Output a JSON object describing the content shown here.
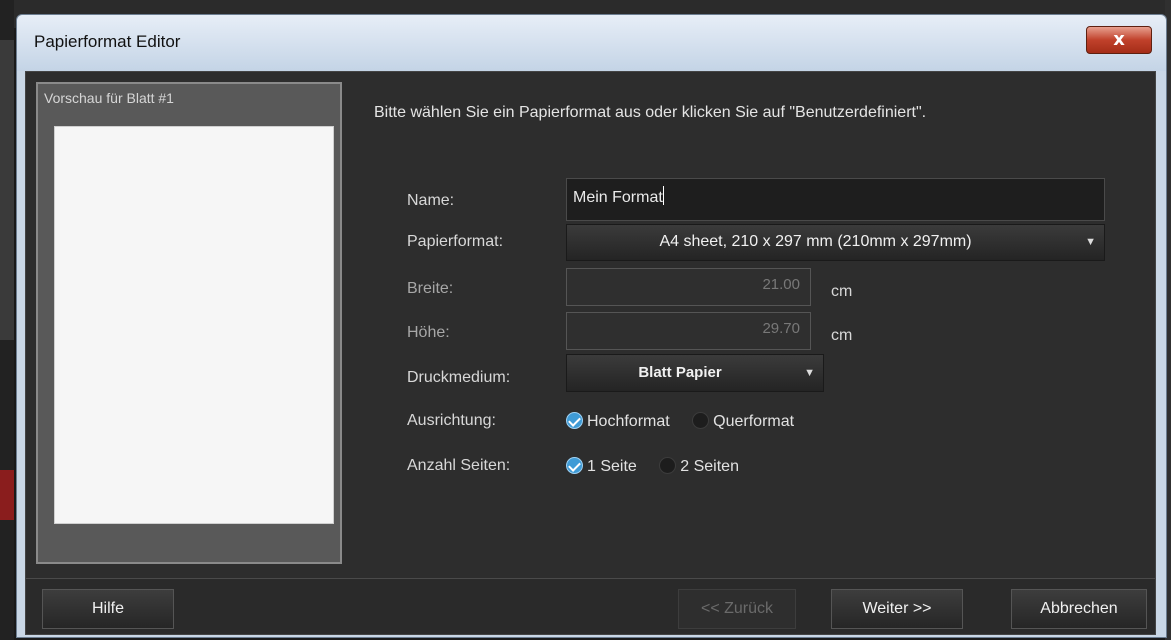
{
  "dialog": {
    "title": "Papierformat Editor",
    "close_label": "x"
  },
  "preview": {
    "label": "Vorschau für Blatt #1"
  },
  "instruction": "Bitte wählen Sie ein Papierformat aus oder klicken Sie auf \"Benutzerdefiniert\".",
  "form": {
    "name_label": "Name:",
    "name_value": "Mein Format",
    "format_label": "Papierformat:",
    "format_value": "A4 sheet, 210 x 297 mm (210mm x 297mm)",
    "width_label": "Breite:",
    "width_value": "21.00",
    "height_label": "Höhe:",
    "height_value": "29.70",
    "unit": "cm",
    "medium_label": "Druckmedium:",
    "medium_value": "Blatt Papier",
    "orientation_label": "Ausrichtung:",
    "orientation_options": [
      "Hochformat",
      "Querformat"
    ],
    "orientation_selected": "Hochformat",
    "pages_label": "Anzahl Seiten:",
    "pages_options": [
      "1 Seite",
      "2 Seiten"
    ],
    "pages_selected": "1 Seite"
  },
  "buttons": {
    "help": "Hilfe",
    "back": "<< Zurück",
    "next": "Weiter >>",
    "cancel": "Abbrechen"
  },
  "colors": {
    "accent": "#3f9bd6",
    "close": "#c0412b"
  }
}
